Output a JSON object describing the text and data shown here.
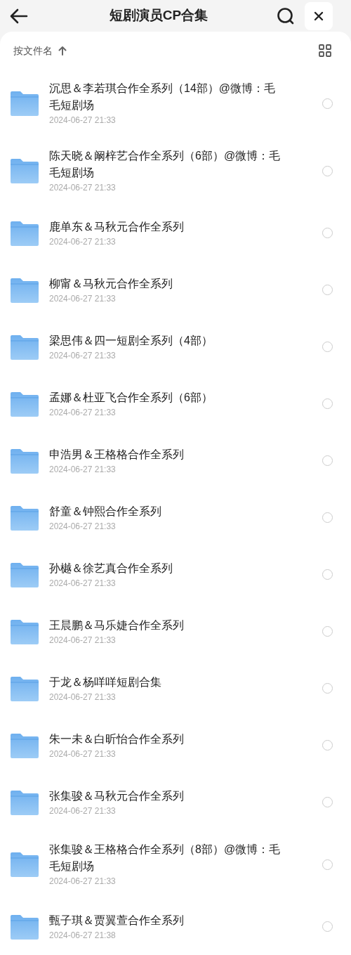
{
  "header": {
    "title": "短剧演员CP合集"
  },
  "sort": {
    "label": "按文件名"
  },
  "files": [
    {
      "name": "沉思＆李若琪合作全系列（14部）@微博：毛毛短剧场",
      "date": "2024-06-27 21:33",
      "selected": false
    },
    {
      "name": "陈天晓＆阚梓艺合作全系列（6部）@微博：毛毛短剧场",
      "date": "2024-06-27 21:33",
      "selected": false
    },
    {
      "name": "鹿单东＆马秋元合作全系列",
      "date": "2024-06-27 21:33",
      "selected": false
    },
    {
      "name": "柳甯＆马秋元合作全系列",
      "date": "2024-06-27 21:33",
      "selected": false
    },
    {
      "name": "梁思伟＆四一短剧全系列（4部）",
      "date": "2024-06-27 21:33",
      "selected": false
    },
    {
      "name": "孟娜＆杜亚飞合作全系列（6部）",
      "date": "2024-06-27 21:33",
      "selected": false
    },
    {
      "name": "申浩男＆王格格合作全系列",
      "date": "2024-06-27 21:33",
      "selected": false
    },
    {
      "name": "舒童＆钟熙合作全系列",
      "date": "2024-06-27 21:33",
      "selected": false
    },
    {
      "name": "孙樾＆徐艺真合作全系列",
      "date": "2024-06-27 21:33",
      "selected": false
    },
    {
      "name": "王晨鹏＆马乐婕合作全系列",
      "date": "2024-06-27 21:33",
      "selected": false
    },
    {
      "name": "于龙＆杨咩咩短剧合集",
      "date": "2024-06-27 21:33",
      "selected": false
    },
    {
      "name": "朱一未＆白昕怡合作全系列",
      "date": "2024-06-27 21:33",
      "selected": false
    },
    {
      "name": "张集骏＆马秋元合作全系列",
      "date": "2024-06-27 21:33",
      "selected": false
    },
    {
      "name": "张集骏＆王格格合作全系列（8部）@微博：毛毛短剧场",
      "date": "2024-06-27 21:33",
      "selected": false
    },
    {
      "name": "甄子琪＆贾翼萱合作全系列",
      "date": "2024-06-27 21:38",
      "selected": false
    }
  ]
}
